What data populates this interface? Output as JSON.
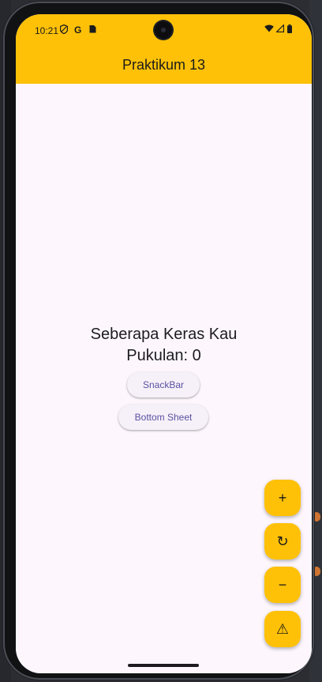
{
  "status_bar": {
    "time": "10:21",
    "left_icons": [
      "shield-icon",
      "google-icon",
      "sim-icon"
    ],
    "right_icons": [
      "wifi-icon",
      "signal-icon",
      "battery-icon"
    ]
  },
  "app_bar": {
    "title": "Praktikum 13"
  },
  "main": {
    "line1": "Seberapa Keras Kau",
    "line2": "Pukulan: 0",
    "snackbar_button": "SnackBar",
    "bottom_sheet_button": "Bottom Sheet"
  },
  "fabs": {
    "increment": "+",
    "reset": "↻",
    "decrement": "−",
    "warning": "⚠"
  },
  "colors": {
    "app_bar": "#ffc107",
    "background": "#fdf7fd",
    "button_text": "#5b4fa3"
  }
}
